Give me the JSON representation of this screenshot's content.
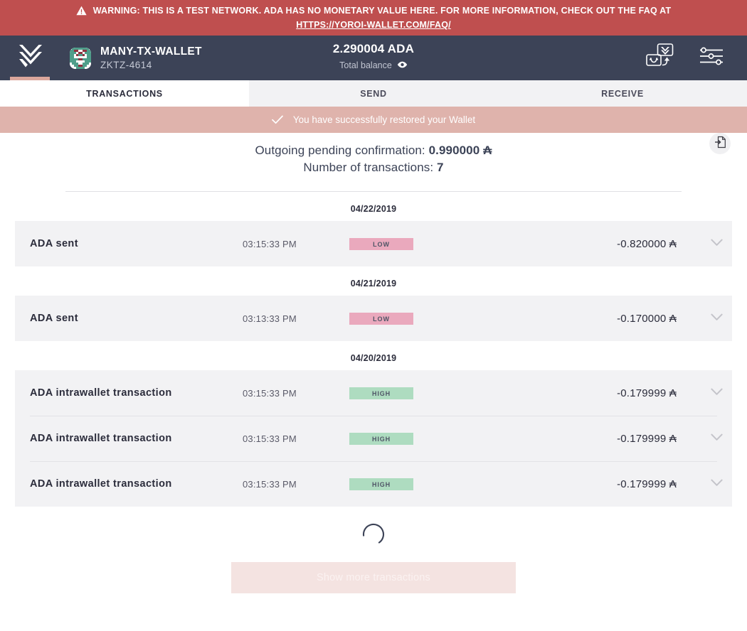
{
  "warning": {
    "icon": "warning-triangle-icon",
    "text": "WARNING: THIS IS A TEST NETWORK. ADA HAS NO MONETARY VALUE HERE. FOR MORE INFORMATION, CHECK OUT THE FAQ AT",
    "link": "HTTPS://YOROI-WALLET.COM/FAQ/",
    "bg_color": "#bf4f4f"
  },
  "topbar": {
    "logo_icon": "yoroi-chevron-logo-icon",
    "avatar_icon": "wallet-identicon-avatar",
    "wallet_name": "MANY-TX-WALLET",
    "wallet_plate": "ZKTZ-4614",
    "balance_amount": "2.290004 ADA",
    "balance_label": "Total balance",
    "balance_eye_icon": "eye-icon",
    "transfer_icon": "wallet-transfer-icon",
    "settings_icon": "settings-sliders-icon",
    "bg_color": "#3c4357"
  },
  "tabs": [
    {
      "label": "TRANSACTIONS",
      "active": true
    },
    {
      "label": "SEND",
      "active": false
    },
    {
      "label": "RECEIVE",
      "active": false
    }
  ],
  "notification": {
    "icon": "check-icon",
    "text": "You have successfully restored your Wallet",
    "bg_color": "#dfb3ac"
  },
  "summary": {
    "pending_label": "Outgoing pending confirmation:",
    "pending_value": "0.990000",
    "pending_unit": "₳",
    "count_label": "Number of transactions:",
    "count_value": "7",
    "export_icon": "export-document-icon"
  },
  "transaction_groups": [
    {
      "date": "04/22/2019",
      "rows": [
        {
          "type": "ADA sent",
          "time": "03:15:33 PM",
          "badge": "LOW",
          "badge_kind": "low",
          "amount": "-0.820000 ₳",
          "chevron_icon": "chevron-down-icon"
        }
      ]
    },
    {
      "date": "04/21/2019",
      "rows": [
        {
          "type": "ADA sent",
          "time": "03:13:33 PM",
          "badge": "LOW",
          "badge_kind": "low",
          "amount": "-0.170000 ₳",
          "chevron_icon": "chevron-down-icon"
        }
      ]
    },
    {
      "date": "04/20/2019",
      "rows": [
        {
          "type": "ADA intrawallet transaction",
          "time": "03:15:33 PM",
          "badge": "HIGH",
          "badge_kind": "high",
          "amount": "-0.179999 ₳",
          "chevron_icon": "chevron-down-icon"
        },
        {
          "type": "ADA intrawallet transaction",
          "time": "03:15:33 PM",
          "badge": "HIGH",
          "badge_kind": "high",
          "amount": "-0.179999 ₳",
          "chevron_icon": "chevron-down-icon"
        },
        {
          "type": "ADA intrawallet transaction",
          "time": "03:15:33 PM",
          "badge": "HIGH",
          "badge_kind": "high",
          "amount": "-0.179999 ₳",
          "chevron_icon": "chevron-down-icon"
        }
      ]
    }
  ],
  "footer": {
    "spinner_icon": "loading-spinner-icon",
    "show_more_label": "Show more transactions",
    "show_more_disabled": true
  },
  "colors": {
    "badge_low": "#eaa9bd",
    "badge_high": "#aedcc0",
    "accent_pink": "#dba79c",
    "nav_dark": "#3c4357",
    "row_bg": "#f2f2f4"
  }
}
